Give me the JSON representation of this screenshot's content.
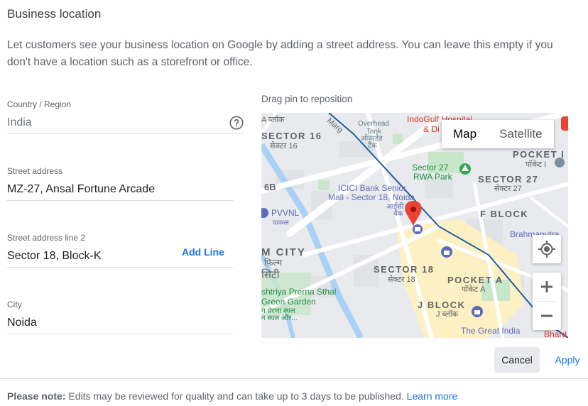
{
  "header": {
    "title": "Business location",
    "description": "Let customers see your business location on Google by adding a street address. You can leave this empty if you don't have a location such as a storefront or office."
  },
  "form": {
    "country": {
      "label": "Country / Region",
      "value": "India",
      "icon": "help-circle-icon"
    },
    "street": {
      "label": "Street address",
      "value": "MZ-27, Ansal Fortune Arcade"
    },
    "street2": {
      "label": "Street address line 2",
      "value": "Sector 18, Block-K"
    },
    "add_line": "Add Line",
    "city": {
      "label": "City",
      "value": "Noida"
    }
  },
  "map": {
    "hint": "Drag pin to reposition",
    "toggle": {
      "map": "Map",
      "satellite": "Satellite",
      "selected": "Map"
    },
    "labels": {
      "sector16": "SECTOR 16",
      "sector16_hi": "सेक्टर 16",
      "a_block": "A ब्लॉक",
      "marg": "Marg",
      "overhead": "Overhead",
      "tank": "Tank",
      "tank_hi_1": "ओवरहेड",
      "tank_hi_2": "टैंक",
      "hospital_1": "IndoGulf Hospital",
      "hospital_2": "& Di",
      "pocket1": "POCKET I",
      "pocket1_hi": "पॉकेट I",
      "rwa_1": "Sector 27",
      "rwa_2": "RWA Park",
      "sector27": "SECTOR 27",
      "sector27_hi": "सेक्टर 27",
      "b6": "6B",
      "icici_1": "ICICI Bank Senior",
      "icici_2": "Mall - Sector 18, Noida",
      "icici_hi": "आईसी",
      "icici_hi_2": "बैंक",
      "pvvnl": "PVVNL",
      "pvvnl_hi": "पव्व्न्ल",
      "fblock": "F BLOCK",
      "brahmaputra": "Brahmaputra",
      "city_en": "M CITY",
      "city_hi_1": "फ़िल्म",
      "city_hi_2": "सिटी",
      "sector18": "SECTOR 18",
      "sector18_hi": "सेक्टर 18",
      "pocketa": "POCKET A",
      "pocketa_hi": "पॉकेट A",
      "prerna_1": "shtriya Prerna Sthal",
      "prerna_2": "Green Garden",
      "prerna_3": "य प्रेरणा स्थल",
      "prerna_4": "न स्थल और...",
      "jblock": "J BLOCK",
      "jblock_hi": "J ब्लॉक",
      "great_india": "The Great India",
      "bhard": "Bhard"
    }
  },
  "actions": {
    "cancel": "Cancel",
    "apply": "Apply"
  },
  "footer": {
    "note_bold": "Please note:",
    "note_text": " Edits may be reviewed for quality and can take up to 3 days to be published. ",
    "learn_more": "Learn more"
  },
  "colors": {
    "accent": "#1a73e8",
    "pin": "#ea4335",
    "map_bg": "#e8eaed",
    "park": "#c8e6c9",
    "highlight": "#fdf1c3"
  }
}
